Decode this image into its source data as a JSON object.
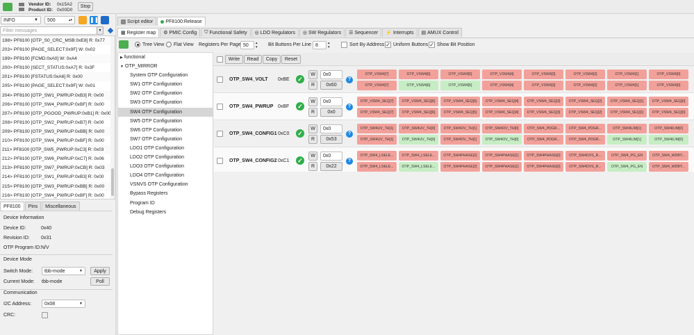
{
  "topbar": {
    "vendor_label": "Vendor ID:",
    "vendor_value": "0x15A2",
    "product_label": "Product ID:",
    "product_value": "0x00D0",
    "stop_label": "Stop"
  },
  "left": {
    "log_level": "INFO",
    "log_count": "500",
    "filter_placeholder": "Filter messages",
    "log_lines": [
      "198> PF8100 [OTP_S0_CRC_MSB:0xE8] R: 0x77",
      "203> PF8100 [PAGE_SELECT:0x9F] W: 0x02",
      "199> PF8100 [FCMD:0xA0] W: 0xA4",
      "200> PF8100 [SECT_STATUS:0xA7] R: 0x3F",
      "201> PF8100 [FSTATUS:0xA6] R: 0x00",
      "205> PF8100 [PAGE_SELECT:0x9F] W: 0x01",
      "204> PF8100 [OTP_SW1_PWRUP:0xB3] R: 0x00",
      "206> PF8100 [OTP_SW4_PWRUP:0xBF] R: 0x00",
      "207> PF8100 [OTP_PGOOD_PWRUP:0xB1] R: 0x00",
      "208> PF8100 [OTP_SW2_PWRUP:0xB7] R: 0x00",
      "209> PF8100 [OTP_SW3_PWRUP:0xBB] R: 0x00",
      "210> PF8100 [OTP_SW4_PWRUP:0xBF] R: 0x00",
      "211> PF8100 [OTP_SW5_PWRUP:0xC3] R: 0x03",
      "212> PF8100 [OTP_SW6_PWRUP:0xC7] R: 0x06",
      "213> PF8100 [OTP_SW7_PWRUP:0xCB] R: 0x03",
      "214> PF8100 [OTP_SW1_PWRUP:0xB3] R: 0x00",
      "215> PF8100 [OTP_SW3_PWRUP:0xBB] R: 0x00",
      "216> PF8100 [OTP_SW4_PWRUP:0xBF] R: 0x00"
    ],
    "tabs": [
      "PF8100",
      "Pins",
      "Miscellaneous"
    ],
    "device_info": {
      "title": "Device Information",
      "device_id_label": "Device ID:",
      "device_id_value": "0x40",
      "revision_label": "Revision ID:",
      "revision_value": "0x31",
      "otp_program_label": "OTP Program ID:",
      "otp_program_value": "N/V"
    },
    "device_mode": {
      "title": "Device Mode",
      "switch_label": "Switch Mode:",
      "switch_value": "tbb-mode",
      "apply_label": "Apply",
      "current_label": "Current Mode:",
      "current_value": "tbb-mode",
      "poll_label": "Poll"
    },
    "communication": {
      "title": "Communication",
      "i2c_label": "I2C Address:",
      "i2c_value": "0x08",
      "crc_label": "CRC:"
    }
  },
  "main": {
    "doc_tabs": [
      "Script editor",
      "PF8100:Release"
    ],
    "tool_tabs": [
      "Register map",
      "PMIC Config",
      "Functional Safety",
      "LDO Regulators",
      "SW Regulators",
      "Sequencer",
      "Interrupts",
      "AMUX Control"
    ],
    "toolbar": {
      "tree_view": "Tree View",
      "flat_view": "Flat View",
      "regs_per_page_label": "Registers Per Page",
      "regs_per_page": "50",
      "bit_buttons_label": "Bit Buttons Per Line",
      "bit_buttons": "8",
      "sort_label": "Sort By Address",
      "uniform_label": "Uniform Buttons",
      "show_bit_label": "Show Bit Position"
    },
    "tree": {
      "functional": "functional",
      "otp_mirror": "OTP_MIRROR",
      "items": [
        "System OTP Configuration",
        "SW1 OTP Configuration",
        "SW2 OTP Configuration",
        "SW3 OTP Configuration",
        "SW4 OTP Configuration",
        "SW5 OTP Configuration",
        "SW6 OTP Configuration",
        "SW7 OTP Configuration",
        "LDO1 OTP Configuration",
        "LDO2 OTP Configuration",
        "LDO3 OTP Configuration",
        "LDO4 OTP Configuration",
        "VSNVS OTP Configuration",
        "Bypass Registers",
        "Program ID",
        "Debug Registers"
      ]
    },
    "actions": [
      "Write",
      "Read",
      "Copy",
      "Reset"
    ],
    "write_btn": "W",
    "read_btn": "R",
    "registers": [
      {
        "name": "OTP_SW4_VOLT",
        "addr": "0xBE",
        "write_value": "0x0",
        "read_value": "0x60",
        "write_bits": [
          [
            "OTP_VSW4[7]",
            "r"
          ],
          [
            "OTP_VSW4[6]",
            "r"
          ],
          [
            "OTP_VSW4[5]",
            "r"
          ],
          [
            "OTP_VSW4[4]",
            "r"
          ],
          [
            "OTP_VSW4[3]",
            "r"
          ],
          [
            "OTP_VSW4[2]",
            "r"
          ],
          [
            "OTP_VSW4[1]",
            "r"
          ],
          [
            "OTP_VSW4[0]",
            "r"
          ]
        ],
        "read_bits": [
          [
            "OTP_VSW4[7]",
            "r"
          ],
          [
            "OTP_VSW4[6]",
            "g"
          ],
          [
            "OTP_VSW4[5]",
            "g"
          ],
          [
            "OTP_VSW4[4]",
            "r"
          ],
          [
            "OTP_VSW4[3]",
            "r"
          ],
          [
            "OTP_VSW4[2]",
            "r"
          ],
          [
            "OTP_VSW4[1]",
            "r"
          ],
          [
            "OTP_VSW4[0]",
            "r"
          ]
        ]
      },
      {
        "name": "OTP_SW4_PWRUP",
        "addr": "0xBF",
        "write_value": "0x0",
        "read_value": "0x0",
        "write_bits": [
          [
            "OTP_VSW4_SEQ[7]",
            "r"
          ],
          [
            "OTP_VSW4_SEQ[6]",
            "r"
          ],
          [
            "OTP_VSW4_SEQ[5]",
            "r"
          ],
          [
            "OTP_VSW4_SEQ[4]",
            "r"
          ],
          [
            "OTP_VSW4_SEQ[3]",
            "r"
          ],
          [
            "OTP_VSW4_SEQ[2]",
            "r"
          ],
          [
            "OTP_VSW4_SEQ[1]",
            "r"
          ],
          [
            "OTP_VSW4_SEQ[0]",
            "r"
          ]
        ],
        "read_bits": [
          [
            "OTP_VSW4_SEQ[7]",
            "r"
          ],
          [
            "OTP_VSW4_SEQ[6]",
            "r"
          ],
          [
            "OTP_VSW4_SEQ[5]",
            "r"
          ],
          [
            "OTP_VSW4_SEQ[4]",
            "r"
          ],
          [
            "OTP_VSW4_SEQ[3]",
            "r"
          ],
          [
            "OTP_VSW4_SEQ[2]",
            "r"
          ],
          [
            "OTP_VSW4_SEQ[1]",
            "r"
          ],
          [
            "OTP_VSW4_SEQ[0]",
            "r"
          ]
        ]
      },
      {
        "name": "OTP_SW4_CONFIG1",
        "addr": "0xC0",
        "write_value": "0x0",
        "read_value": "0x53",
        "write_bits": [
          [
            "OTP_SW4UV_TH[1]",
            "r"
          ],
          [
            "OTP_SW4UV_TH[0]",
            "r"
          ],
          [
            "OTP_SW4OV_TH[1]",
            "r"
          ],
          [
            "OTP_SW4OV_TH[0]",
            "r"
          ],
          [
            "OTP_SW4_PDGR...",
            "r"
          ],
          [
            "OTP_SW4_PDGR...",
            "r"
          ],
          [
            "OTP_SW4ILIM[1]",
            "r"
          ],
          [
            "OTP_SW4ILIM[0]",
            "r"
          ]
        ],
        "read_bits": [
          [
            "OTP_SW4UV_TH[1]",
            "r"
          ],
          [
            "OTP_SW4UV_TH[0]",
            "g"
          ],
          [
            "OTP_SW4OV_TH[1]",
            "r"
          ],
          [
            "OTP_SW4OV_TH[0]",
            "g"
          ],
          [
            "OTP_SW4_PDGR...",
            "r"
          ],
          [
            "OTP_SW4_PDGR...",
            "r"
          ],
          [
            "OTP_SW4ILIM[1]",
            "g"
          ],
          [
            "OTP_SW4ILIM[0]",
            "g"
          ]
        ]
      },
      {
        "name": "OTP_SW4_CONFIG2",
        "addr": "0xC1",
        "write_value": "0x0",
        "read_value": "0x22",
        "write_bits": [
          [
            "OTP_SW4_LSELE...",
            "r"
          ],
          [
            "OTP_SW4_LSELE...",
            "r"
          ],
          [
            "OTP_SW4PHASE[2]",
            "r"
          ],
          [
            "OTP_SW4PHASE[1]",
            "r"
          ],
          [
            "OTP_SW4PHASE[0]",
            "r"
          ],
          [
            "OTP_SW4DVS_R...",
            "r"
          ],
          [
            "OTP_SW4_PG_EN",
            "r"
          ],
          [
            "OTP_SW4_WDBY...",
            "r"
          ]
        ],
        "read_bits": [
          [
            "OTP_SW4_LSELE...",
            "r"
          ],
          [
            "OTP_SW4_LSELE...",
            "g"
          ],
          [
            "OTP_SW4PHASE[2]",
            "r"
          ],
          [
            "OTP_SW4PHASE[1]",
            "r"
          ],
          [
            "OTP_SW4PHASE[0]",
            "r"
          ],
          [
            "OTP_SW4DVS_R...",
            "r"
          ],
          [
            "OTP_SW4_PG_EN",
            "g"
          ],
          [
            "OTP_SW4_WDBY...",
            "r"
          ]
        ]
      }
    ]
  }
}
